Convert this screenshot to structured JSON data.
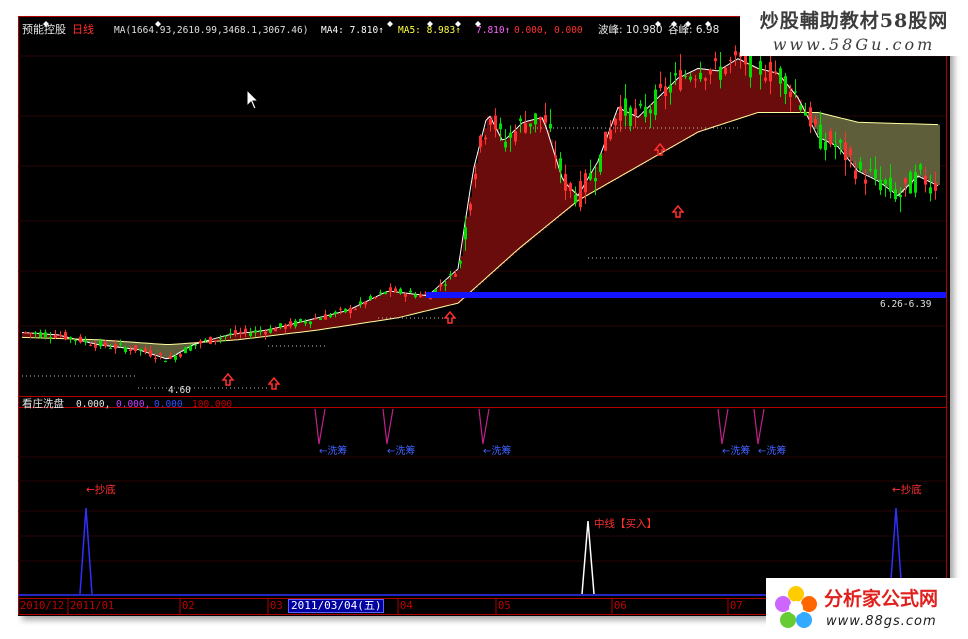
{
  "header": {
    "title": "预能控股",
    "period": "日线",
    "ma_main": "MA(1664.93,2610.99,3468.1,3067.46)",
    "ma4": "MA4: 7.810↑",
    "ma5": "MA5: 8.983↑",
    "ind1": "7.810↑",
    "ind2": "0.000, 0.000",
    "peak": "波峰: 10.980",
    "valley": "谷峰: 6.98"
  },
  "price_labels": {
    "low": "4.60",
    "range": "6.26-6.39"
  },
  "sub1": {
    "title": "看庄洗盘",
    "v1": "0.000,",
    "v2": "0.000,",
    "v3": "0.000",
    "v4": "100.000",
    "signal_label": "←洗筹",
    "signal_x": [
      297,
      365,
      461,
      700,
      736
    ]
  },
  "sub2": {
    "bottom_label": "←抄底",
    "buy_label": "中线【买入】"
  },
  "xaxis": {
    "labels": [
      "2010/12",
      "2011/01",
      "02",
      "03",
      "04",
      "05",
      "06",
      "07"
    ],
    "cursor_date": "2011/03/04(五)"
  },
  "brand_top": {
    "title": "炒股輔助教材58股网",
    "url": "www.58Gu.com"
  },
  "brand_bottom": {
    "name": "分析家公式网",
    "url": "www.88gs.com"
  },
  "colors": {
    "up": "#ff3030",
    "down": "#00e000",
    "fill_red": "#6a0c0c",
    "fill_olive": "#5e5e3a",
    "blue_line": "#1414ff",
    "axis": "#b00000"
  }
}
